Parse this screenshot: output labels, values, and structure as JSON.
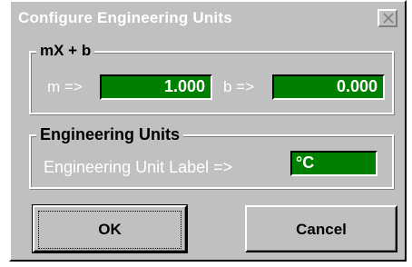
{
  "window": {
    "title": "Configure Engineering Units",
    "close_icon": "close-icon"
  },
  "mxb_group": {
    "legend": "mX + b",
    "m_label": "m =>",
    "m_value": "1.000",
    "b_label": "b =>",
    "b_value": "0.000"
  },
  "units_group": {
    "legend": "Engineering Units",
    "label_caption": "Engineering Unit Label =>",
    "label_value": "°C"
  },
  "buttons": {
    "ok": "OK",
    "cancel": "Cancel"
  },
  "colors": {
    "face": "#c0c0c0",
    "field": "#008000",
    "text_light": "#ffffff"
  }
}
